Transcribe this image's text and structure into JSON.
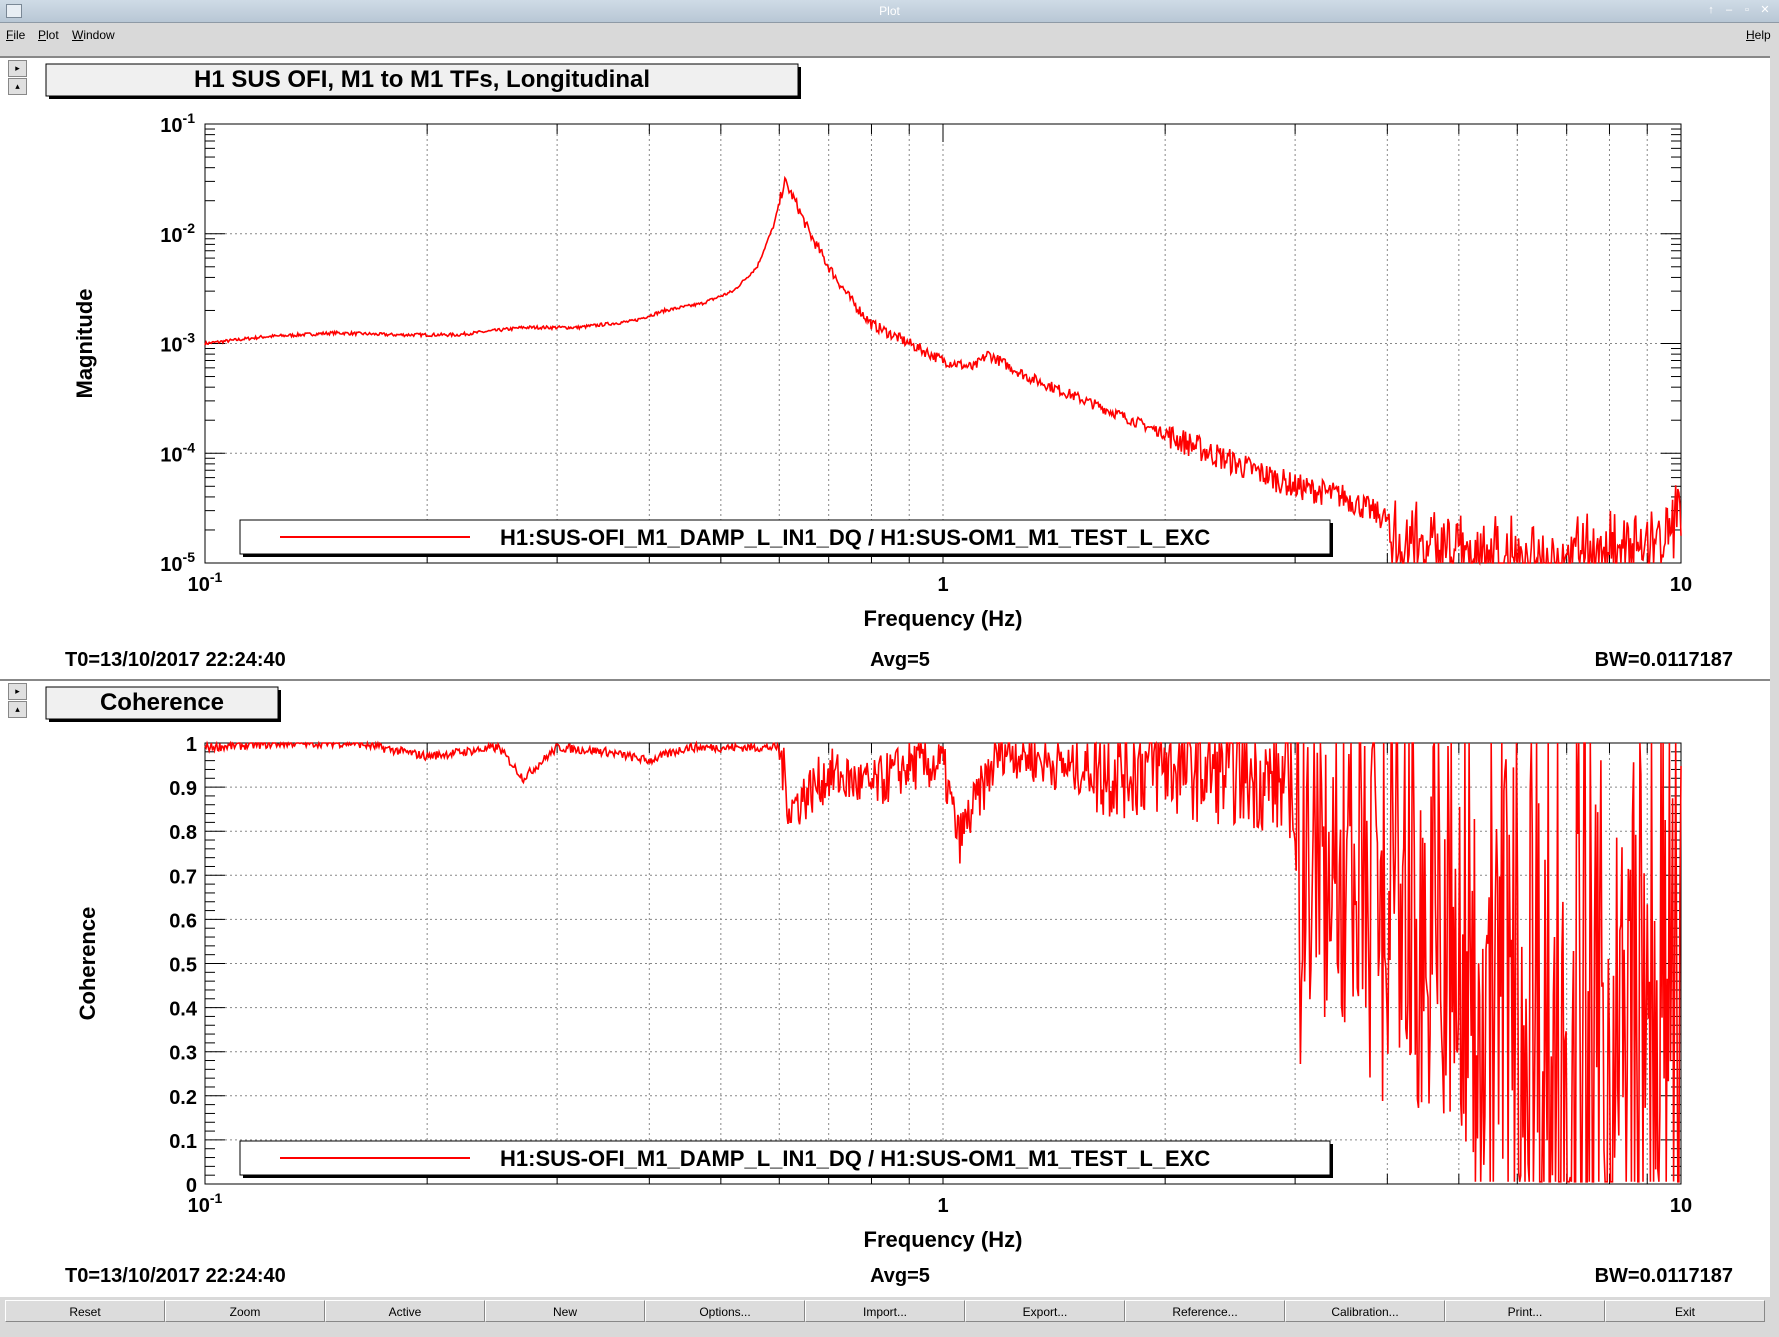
{
  "window": {
    "title": "Plot",
    "controls": [
      "↑",
      "‒",
      "▫",
      "✕"
    ]
  },
  "menu": {
    "file": "File",
    "plot": "Plot",
    "window": "Window",
    "help": "Help"
  },
  "buttons": [
    "Reset",
    "Zoom",
    "Active",
    "New",
    "Options...",
    "Import...",
    "Export...",
    "Reference...",
    "Calibration...",
    "Print...",
    "Exit"
  ],
  "side_arrows": {
    "right": "▸",
    "up": "▴"
  },
  "colors": {
    "trace": "#ff0000",
    "grid": "#888888"
  },
  "chart_data": [
    {
      "type": "line",
      "title": "H1 SUS OFI, M1 to M1 TFs, Longitudinal",
      "xlabel": "Frequency (Hz)",
      "ylabel": "Magnitude",
      "xscale": "log",
      "yscale": "log",
      "xlim": [
        0.1,
        10
      ],
      "ylim": [
        1e-05,
        0.1
      ],
      "x_ticks": [
        {
          "value": 0.1,
          "base": "10",
          "exp": "-1"
        },
        {
          "value": 1,
          "base": "1",
          "exp": ""
        },
        {
          "value": 10,
          "base": "10",
          "exp": ""
        }
      ],
      "y_ticks": [
        {
          "value": 0.1,
          "base": "10",
          "exp": "-1"
        },
        {
          "value": 0.01,
          "base": "10",
          "exp": "-2"
        },
        {
          "value": 0.001,
          "base": "10",
          "exp": "-3"
        },
        {
          "value": 0.0001,
          "base": "10",
          "exp": "-4"
        },
        {
          "value": 1e-05,
          "base": "10",
          "exp": "-5"
        }
      ],
      "grid": true,
      "legend": "bottom-center",
      "footer": {
        "t0": "T0=13/10/2017 22:24:40",
        "avg": "Avg=5",
        "bw": "BW=0.0117187"
      },
      "series": [
        {
          "name": "H1:SUS-OFI_M1_DAMP_L_IN1_DQ / H1:SUS-OM1_M1_TEST_L_EXC",
          "x": [
            0.1,
            0.12,
            0.15,
            0.18,
            0.22,
            0.27,
            0.32,
            0.38,
            0.42,
            0.47,
            0.52,
            0.56,
            0.59,
            0.61,
            0.63,
            0.66,
            0.7,
            0.75,
            0.8,
            0.9,
            1.0,
            1.1,
            1.15,
            1.3,
            1.6,
            2.0,
            2.5,
            3.0,
            3.5,
            4.0,
            5.0,
            6.0,
            7.0,
            8.0,
            9.0,
            10.0
          ],
          "y": [
            0.001,
            0.00115,
            0.00125,
            0.0012,
            0.0012,
            0.0014,
            0.0014,
            0.0016,
            0.002,
            0.0023,
            0.003,
            0.005,
            0.012,
            0.03,
            0.02,
            0.01,
            0.005,
            0.0025,
            0.0015,
            0.001,
            0.0007,
            0.0006,
            0.0008,
            0.0005,
            0.00028,
            0.00015,
            8e-05,
            5e-05,
            4e-05,
            2.5e-05,
            1.8e-05,
            1.5e-05,
            1.8e-05,
            2e-05,
            2.2e-05,
            4e-05
          ]
        }
      ]
    },
    {
      "type": "line",
      "title": "Coherence",
      "xlabel": "Frequency (Hz)",
      "ylabel": "Coherence",
      "xscale": "log",
      "xlim": [
        0.1,
        10
      ],
      "ylim": [
        0,
        1
      ],
      "x_ticks": [
        {
          "value": 0.1,
          "base": "10",
          "exp": "-1"
        },
        {
          "value": 1,
          "base": "1",
          "exp": ""
        },
        {
          "value": 10,
          "base": "10",
          "exp": ""
        }
      ],
      "y_ticks": [
        {
          "value": 0,
          "label": "0"
        },
        {
          "value": 0.1,
          "label": "0.1"
        },
        {
          "value": 0.2,
          "label": "0.2"
        },
        {
          "value": 0.3,
          "label": "0.3"
        },
        {
          "value": 0.4,
          "label": "0.4"
        },
        {
          "value": 0.5,
          "label": "0.5"
        },
        {
          "value": 0.6,
          "label": "0.6"
        },
        {
          "value": 0.7,
          "label": "0.7"
        },
        {
          "value": 0.8,
          "label": "0.8"
        },
        {
          "value": 0.9,
          "label": "0.9"
        },
        {
          "value": 1,
          "label": "1"
        }
      ],
      "grid": true,
      "legend": "bottom-center",
      "footer": {
        "t0": "T0=13/10/2017 22:24:40",
        "avg": "Avg=5",
        "bw": "BW=0.0117187"
      },
      "series": [
        {
          "name": "H1:SUS-OFI_M1_DAMP_L_IN1_DQ / H1:SUS-OM1_M1_TEST_L_EXC",
          "x": [
            0.1,
            0.13,
            0.16,
            0.2,
            0.25,
            0.27,
            0.3,
            0.35,
            0.4,
            0.45,
            0.5,
            0.6,
            0.62,
            0.7,
            0.8,
            0.9,
            1.0,
            1.05,
            1.2,
            1.5,
            2.0,
            2.5,
            3.0,
            3.2,
            3.5,
            4.0,
            4.5,
            5.0,
            5.5,
            6.0,
            7.0,
            8.0,
            9.0,
            10.0
          ],
          "y": [
            0.99,
            1.0,
            1.0,
            0.97,
            0.99,
            0.92,
            0.99,
            0.98,
            0.96,
            0.99,
            0.99,
            0.99,
            0.85,
            0.93,
            0.9,
            0.95,
            0.95,
            0.78,
            0.99,
            0.94,
            0.95,
            0.93,
            0.9,
            0.72,
            0.85,
            0.75,
            0.6,
            0.45,
            0.6,
            0.4,
            0.3,
            0.25,
            0.3,
            0.45
          ]
        }
      ]
    }
  ]
}
